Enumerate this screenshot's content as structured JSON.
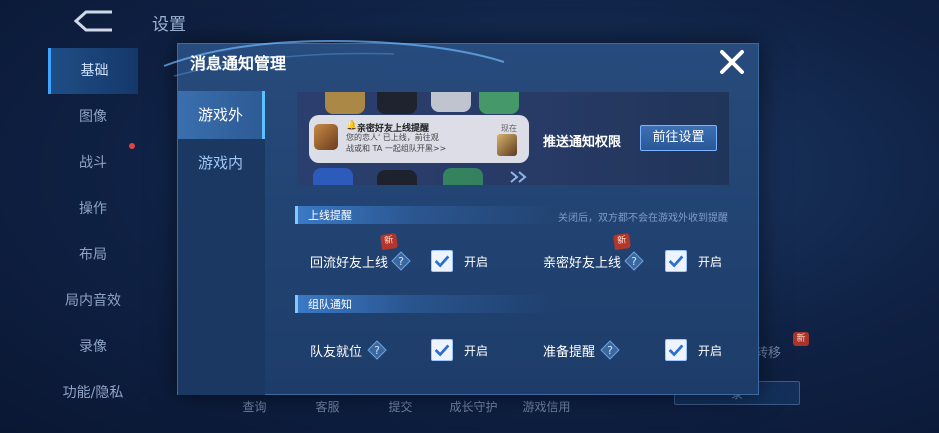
{
  "background": {
    "title": "设置",
    "sidebar": [
      "基础",
      "图像",
      "战斗",
      "操作",
      "布局",
      "局内音效",
      "录像",
      "功能/隐私"
    ],
    "bottom_items": [
      "查询",
      "客服",
      "提交",
      "成长守护",
      "游戏信用"
    ],
    "right_text": "转移",
    "right_button": "录",
    "new_badge": "新"
  },
  "modal": {
    "title": "消息通知管理",
    "tabs": [
      {
        "label": "游戏外",
        "active": true
      },
      {
        "label": "游戏内",
        "active": false
      }
    ],
    "banner": {
      "notification": {
        "title": "亲密好友上线提醒",
        "time": "现在",
        "line1": "您的恋人'  已上线，前往观",
        "line2": "战或和 TA 一起组队开黑>>"
      },
      "push_permission_label": "推送通知权限",
      "goto_settings_button": "前往设置"
    },
    "sections": {
      "online": {
        "title": "上线提醒",
        "hint": "关闭后，双方都不会在游戏外收到提醒",
        "items": [
          {
            "label": "回流好友上线",
            "new_badge": "新",
            "checked": true,
            "state_text": "开启"
          },
          {
            "label": "亲密好友上线",
            "new_badge": "新",
            "checked": true,
            "state_text": "开启"
          }
        ]
      },
      "team": {
        "title": "组队通知",
        "items": [
          {
            "label": "队友就位",
            "checked": true,
            "state_text": "开启"
          },
          {
            "label": "准备提醒",
            "checked": true,
            "state_text": "开启"
          }
        ]
      }
    }
  },
  "colors": {
    "accent": "#5fc0ff",
    "new_badge": "#b3362c",
    "check": "#2b6fcf"
  },
  "icons": {
    "close": "close-icon",
    "help": "help-diamond-icon",
    "checkbox": "checkmark-icon",
    "back": "back-arrow-icon"
  }
}
